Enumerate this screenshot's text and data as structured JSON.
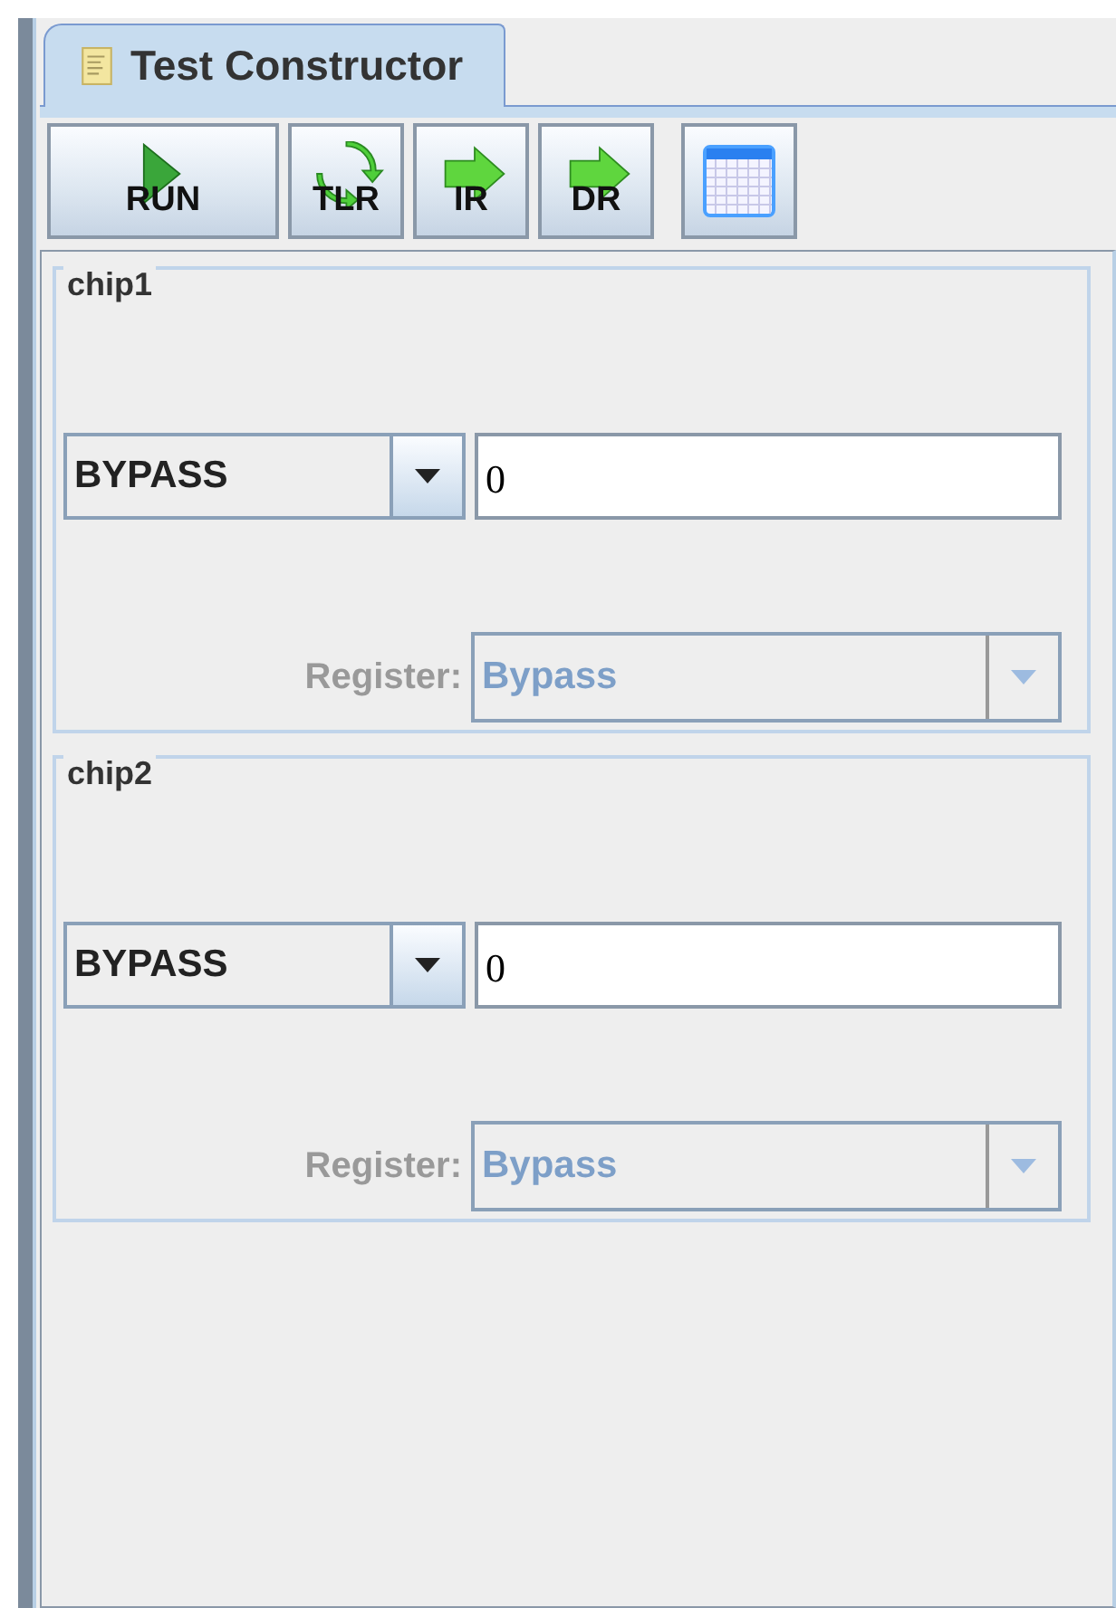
{
  "tabs": [
    {
      "label": "Test Constructor",
      "selected": true
    }
  ],
  "toolbar": [
    {
      "kind": "play",
      "label": "RUN"
    },
    {
      "kind": "cycle",
      "label": "TLR"
    },
    {
      "kind": "arrow",
      "label": "IR"
    },
    {
      "kind": "arrow",
      "label": "DR"
    },
    {
      "kind": "table"
    }
  ],
  "chips": [
    {
      "title": "chip1",
      "instruction": "BYPASS",
      "value": "0",
      "register_label": "Register:",
      "register": "Bypass",
      "register_disabled": true
    },
    {
      "title": "chip2",
      "instruction": "BYPASS",
      "value": "0",
      "register_label": "Register:",
      "register": "Bypass",
      "register_disabled": true
    }
  ]
}
